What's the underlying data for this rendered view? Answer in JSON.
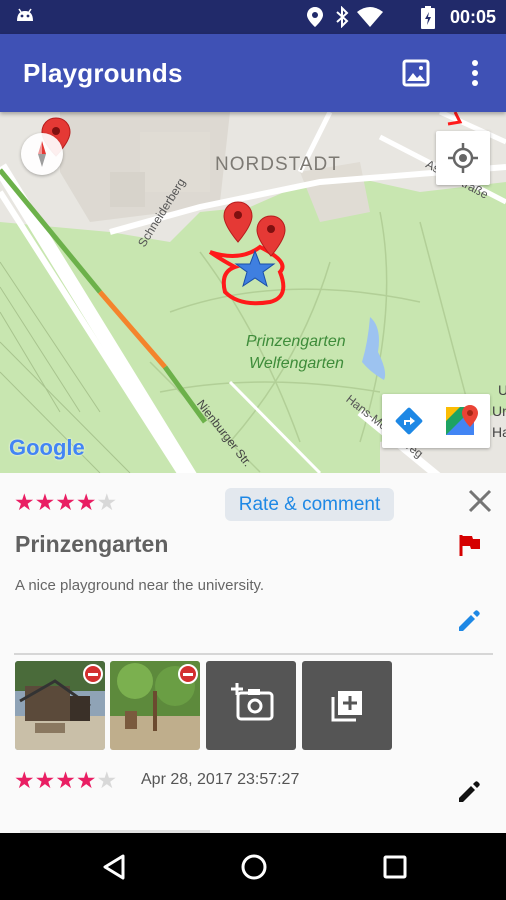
{
  "status_bar": {
    "time": "00:05",
    "icons": [
      "android-icon",
      "location-icon",
      "bluetooth-icon",
      "wifi-icon",
      "battery-charging-icon"
    ]
  },
  "app_bar": {
    "title": "Playgrounds",
    "actions": [
      "image-icon",
      "more-vert-icon"
    ]
  },
  "map": {
    "district_label": "NORDSTADT",
    "park_label_line1": "Prinzengarten",
    "park_label_line2": "Welfengarten",
    "street_labels": [
      "Schneiderberg",
      "Nienburger Str.",
      "Hans-Meyer-Weg",
      "Asternstraße"
    ],
    "edge_text": [
      "U",
      "Un",
      "Ha"
    ],
    "logo": "Google",
    "controls": [
      "compass-icon",
      "my-location-icon",
      "directions-icon",
      "google-maps-icon"
    ],
    "colors": {
      "park": "#c8e6b0",
      "route": "#ff1a1a",
      "marker": "#e53935",
      "selected": "#3f7fe0"
    }
  },
  "playground": {
    "rating": 4,
    "max_rating": 5,
    "rate_button": "Rate & comment",
    "name": "Prinzengarten",
    "description": "A nice playground near the university.",
    "photos": 2,
    "add_photo_icons": [
      "add-a-photo-icon",
      "add-from-library-icon"
    ],
    "review": {
      "rating": 4,
      "date": "Apr 28, 2017 23:57:27"
    }
  },
  "colors": {
    "primary": "#3f51b5",
    "status_bar": "#212a6a",
    "star": "#e91e63",
    "flag": "#d50000",
    "edit": "#1e88e5"
  }
}
